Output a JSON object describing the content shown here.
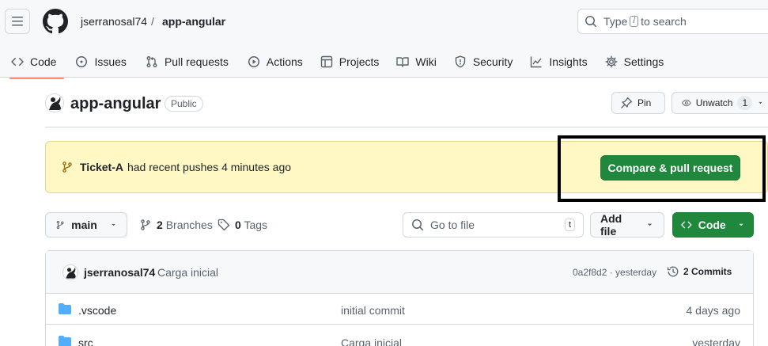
{
  "header": {
    "owner": "jserranosal74",
    "separator": "/",
    "repo": "app-angular",
    "search": {
      "prefix": "Type",
      "key": "/",
      "suffix": "to search"
    }
  },
  "tabs": [
    {
      "label": "Code",
      "icon": "code-icon",
      "active": true
    },
    {
      "label": "Issues",
      "icon": "issue-icon"
    },
    {
      "label": "Pull requests",
      "icon": "pull-request-icon"
    },
    {
      "label": "Actions",
      "icon": "play-icon"
    },
    {
      "label": "Projects",
      "icon": "table-icon"
    },
    {
      "label": "Wiki",
      "icon": "book-icon"
    },
    {
      "label": "Security",
      "icon": "shield-icon"
    },
    {
      "label": "Insights",
      "icon": "graph-icon"
    },
    {
      "label": "Settings",
      "icon": "gear-icon"
    }
  ],
  "repo_header": {
    "name": "app-angular",
    "visibility": "Public",
    "pin_label": "Pin",
    "watch_label": "Unwatch",
    "watch_count": "1"
  },
  "banner": {
    "branch": "Ticket-A",
    "text": "had recent pushes 4 minutes ago",
    "button": "Compare & pull request"
  },
  "toolbar": {
    "branch": "main",
    "branches_count": "2",
    "branches_label": "Branches",
    "tags_count": "0",
    "tags_label": "Tags",
    "goto_placeholder": "Go to file",
    "goto_key": "t",
    "add_file": "Add file",
    "code": "Code"
  },
  "latest_commit": {
    "author": "jserranosal74",
    "message": "Carga inicial",
    "hash_time": "0a2f8d2 · yesterday",
    "commits": "2 Commits"
  },
  "files": [
    {
      "name": ".vscode",
      "message": "initial commit",
      "age": "4 days ago",
      "icon": "folder-icon"
    },
    {
      "name": "src",
      "message": "Carga inicial",
      "age": "yesterday",
      "icon": "folder-icon"
    }
  ],
  "colors": {
    "primary_green": "#1f883d",
    "banner_bg": "#fff8c5",
    "active_tab_underline": "#fd8c73",
    "folder_blue": "#54aeff"
  }
}
